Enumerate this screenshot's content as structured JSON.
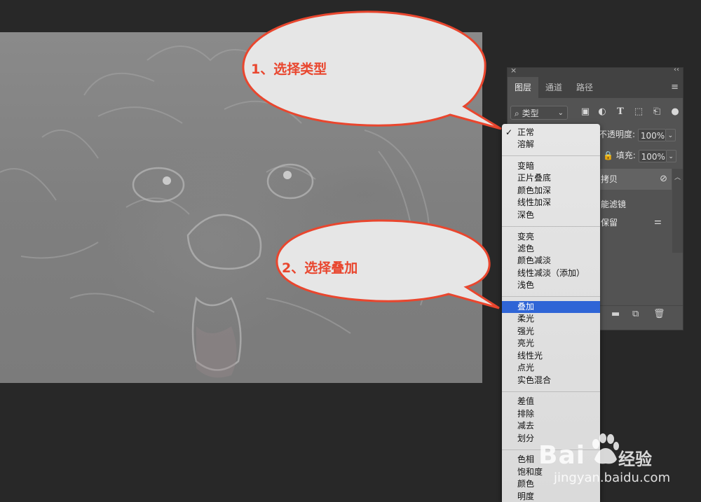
{
  "callouts": {
    "step1": "1、选择类型",
    "step2": "2、选择叠加"
  },
  "layers_panel": {
    "close_glyph": "×",
    "collapse_glyph": "‹‹",
    "tabs": [
      "图层",
      "通道",
      "路径"
    ],
    "active_tab": "图层",
    "filter_label": "类型",
    "opacity_label": "不透明度:",
    "opacity_value": "100%",
    "fill_label": "填充:",
    "fill_value": "100%",
    "layer_name_partial": "拷贝",
    "smart_filter_partial": "能滤镜",
    "filter_item_partial": "保留"
  },
  "blend_menu": {
    "selected": "叠加",
    "checked": "正常",
    "groups": [
      [
        "正常",
        "溶解"
      ],
      [
        "变暗",
        "正片叠底",
        "颜色加深",
        "线性加深",
        "深色"
      ],
      [
        "变亮",
        "滤色",
        "颜色减淡",
        "线性减淡（添加）",
        "浅色"
      ],
      [
        "叠加",
        "柔光",
        "强光",
        "亮光",
        "线性光",
        "点光",
        "实色混合"
      ],
      [
        "差值",
        "排除",
        "减去",
        "划分"
      ],
      [
        "色相",
        "饱和度",
        "颜色",
        "明度"
      ]
    ]
  },
  "watermark": {
    "brand": "Bai",
    "brand_suffix": "经验",
    "url": "jingyan.baidu.com"
  },
  "colors": {
    "accent_text": "#e9462e",
    "selection": "#2f65d6",
    "panel_bg": "#535353",
    "app_bg": "#282828"
  }
}
